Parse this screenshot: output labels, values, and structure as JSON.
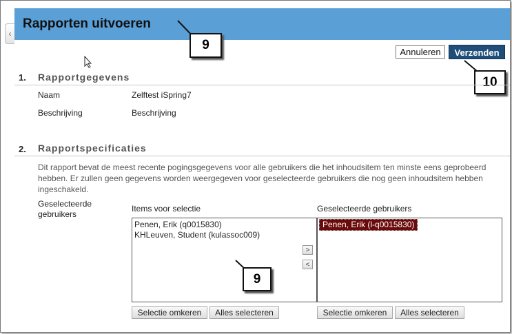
{
  "window": {
    "title": "Rapporten uitvoeren"
  },
  "toolbar": {
    "cancel_label": "Annuleren",
    "submit_label": "Verzenden"
  },
  "callouts": {
    "header_step": "9",
    "submit_step": "10",
    "list_step": "9"
  },
  "section1": {
    "number": "1.",
    "title": "Rapportgegevens",
    "name_label": "Naam",
    "name_value": "Zelftest iSpring7",
    "description_label": "Beschrijving",
    "description_value": "Beschrijving"
  },
  "section2": {
    "number": "2.",
    "title": "Rapportspecificaties",
    "description": "Dit rapport bevat de meest recente pogingsgegevens voor alle gebruikers die het inhoudsitem ten minste eens geprobeerd hebben. Er zullen geen gegevens worden weergegeven voor geselecteerde gebruikers die nog geen inhoudsitem hebben ingeschakeld.",
    "selected_users_label": "Geselecteerde gebruikers",
    "available_header": "Items voor selectie",
    "selected_header": "Geselecteerde gebruikers",
    "available_items": [
      "Penen, Erik (q0015830)",
      "KHLeuven, Student (kulassoc009)"
    ],
    "selected_items": [
      "Penen, Erik (l-q0015830)"
    ],
    "move_right_icon": ">",
    "move_left_icon": "<",
    "available_buttons": {
      "invert": "Selectie omkeren",
      "select_all": "Alles selecteren"
    },
    "selected_buttons": {
      "invert": "Selectie omkeren",
      "select_all": "Alles selecteren"
    }
  },
  "icons": {
    "collapse": "chevron-left-icon",
    "cursor": "mouse-pointer-icon"
  },
  "colors": {
    "header_bg": "#5a9fd6",
    "submit_bg": "#1f4e79",
    "selected_item_bg": "#6a0a0a"
  }
}
